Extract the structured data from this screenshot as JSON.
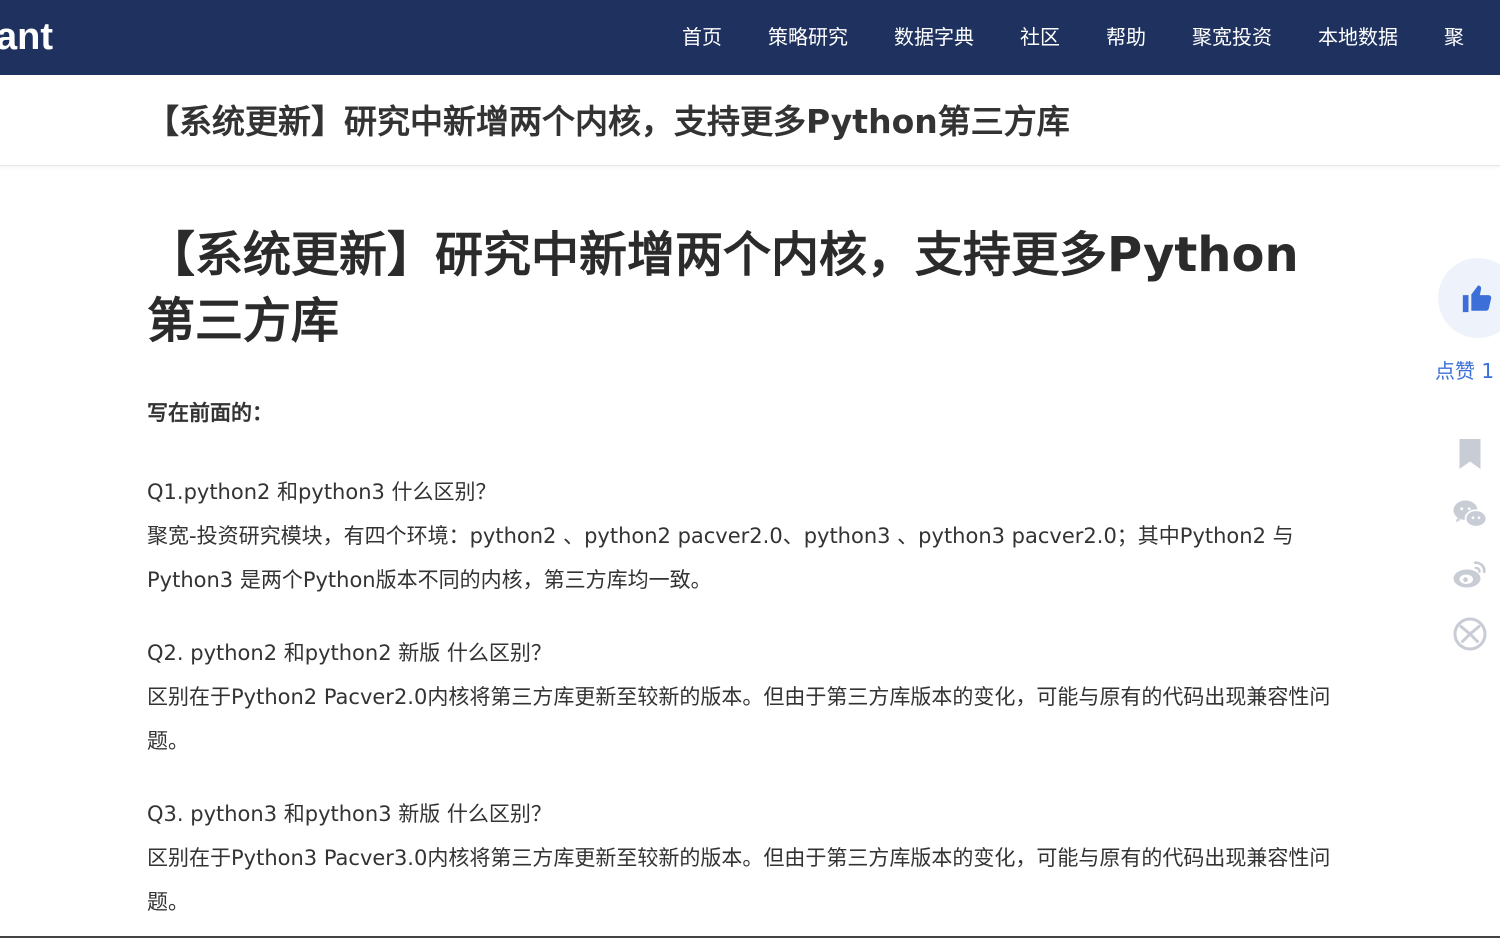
{
  "header": {
    "logo_text": "ant",
    "nav": [
      "首页",
      "策略研究",
      "数据字典",
      "社区",
      "帮助",
      "聚宽投资",
      "本地数据",
      "聚"
    ]
  },
  "subheader": {
    "title": "【系统更新】研究中新增两个内核，支持更多Python第三方库"
  },
  "article": {
    "title": "【系统更新】研究中新增两个内核，支持更多Python第三方库",
    "intro": "写在前面的：",
    "qa": [
      {
        "q": "Q1.python2 和python3 什么区别？",
        "a": "聚宽-投资研究模块，有四个环境：python2 、python2 pacver2.0、python3 、python3 pacver2.0；其中Python2 与 Python3 是两个Python版本不同的内核，第三方库均一致。"
      },
      {
        "q": "Q2. python2 和python2 新版 什么区别？",
        "a": "区别在于Python2 Pacver2.0内核将第三方库更新至较新的版本。但由于第三方库版本的变化，可能与原有的代码出现兼容性问题。"
      },
      {
        "q": "Q3. python3 和python3 新版 什么区别？",
        "a": "区别在于Python3 Pacver3.0内核将第三方库更新至较新的版本。但由于第三方库版本的变化，可能与原有的代码出现兼容性问题。"
      }
    ]
  },
  "sidebar": {
    "like_label": "点赞 1",
    "icons": [
      "thumbs-up-icon",
      "bookmark-icon",
      "wechat-icon",
      "weibo-icon",
      "qzone-icon"
    ],
    "accent_color": "#3c6fd8",
    "icon_color": "#c8ccd4"
  },
  "colors": {
    "header_bg": "#1f325f",
    "text": "#333333"
  }
}
